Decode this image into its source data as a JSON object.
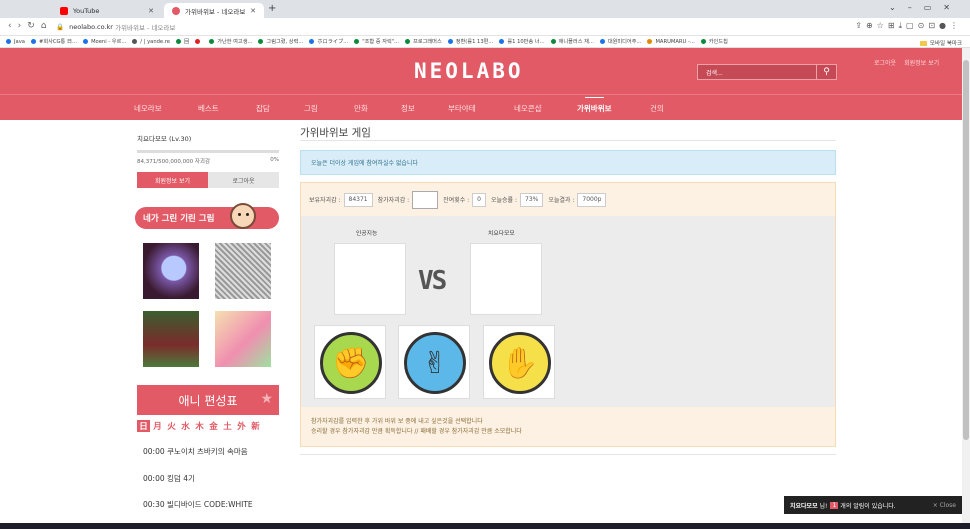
{
  "browser": {
    "tabs": [
      {
        "title": "YouTube",
        "color": "#ff0000",
        "active": false
      },
      {
        "title": "가위바위보 - 네오라보",
        "color": "#e15a65",
        "active": true
      }
    ],
    "new_tab": "+",
    "url_host": "neolabo.co.kr",
    "url_path": "가위바위보 - 네오라보",
    "bookmarks": [
      {
        "label": "Java",
        "color": "#1a73e8"
      },
      {
        "label": "#회사CG통 日...",
        "color": "#1a73e8"
      },
      {
        "label": "Moeni - 우르...",
        "color": "#1a73e8"
      },
      {
        "label": "/ | yande.re",
        "color": "#555555"
      },
      {
        "label": "回",
        "color": "#0a8a3a"
      },
      {
        "label": "",
        "color": "#e02020"
      },
      {
        "label": "가난한 여고생...",
        "color": "#0a8a3a"
      },
      {
        "label": "그림그렸, 상력...",
        "color": "#0a8a3a"
      },
      {
        "label": "ホロライブ...",
        "color": "#1a73e8"
      },
      {
        "label": "\"조합 중 자릭\"...",
        "color": "#0a8a3a"
      },
      {
        "label": "프로그래머스",
        "color": "#0a8a3a"
      },
      {
        "label": "정환(률1 13편...",
        "color": "#1a73e8"
      },
      {
        "label": "률1 10만송 너...",
        "color": "#1a73e8"
      },
      {
        "label": "애니플러스 재...",
        "color": "#0a8a3a"
      },
      {
        "label": "대원미디어주...",
        "color": "#1a73e8"
      },
      {
        "label": "MARUMARU -...",
        "color": "#e08a00"
      },
      {
        "label": "카인드칩",
        "color": "#0a8a3a"
      }
    ],
    "mobile_bookmarks": "모바일 북마크"
  },
  "site": {
    "logo": "NEOLABO",
    "search_placeholder": "검색...",
    "top_links": [
      "로그아웃",
      "회원정보 보기"
    ],
    "menu": [
      {
        "label": "네오라보",
        "active": false
      },
      {
        "label": "베스트",
        "active": false
      },
      {
        "label": "잡담",
        "active": false
      },
      {
        "label": "그림",
        "active": false
      },
      {
        "label": "만화",
        "active": false
      },
      {
        "label": "정보",
        "active": false
      },
      {
        "label": "부타야테",
        "active": false
      },
      {
        "label": "네오콘샵",
        "active": false
      },
      {
        "label": "가위바위보",
        "active": true
      },
      {
        "label": "건의",
        "active": false
      }
    ]
  },
  "sidebar": {
    "user_name": "치요다모모 (Lv.30)",
    "exp": "84,371/500,000,000 자괴감",
    "exp_percent": "0%",
    "btn_info": "회원정보 보기",
    "btn_logout": "로그아웃",
    "banner": "네가 그린 기린 그림",
    "anime_title": "애니 편성표",
    "days": [
      "日",
      "月",
      "火",
      "水",
      "木",
      "金",
      "土",
      "外",
      "新"
    ],
    "selected_day": 0,
    "schedule": [
      {
        "time": "00:00",
        "title": "쿠노이치 츠바키의 속마음"
      },
      {
        "time": "00:00",
        "title": "킹덤 4기"
      },
      {
        "time": "00:30",
        "title": "빌디바이드 CODE:WHITE"
      }
    ]
  },
  "main": {
    "title": "가위바위보 게임",
    "notice": "오늘은 더이상 게임에 참여하실수 없습니다",
    "stats": {
      "owned_label": "보유자괴감 :",
      "owned_value": "84371",
      "bet_label": "참가자괴감 :",
      "remaining_label": "잔여횟수 :",
      "remaining_value": "0",
      "win_rate_label": "오늘승률 :",
      "win_rate_value": "73%",
      "result_label": "오늘결과 :",
      "result_value": "7000p"
    },
    "player_left": "인공지능",
    "player_right": "치요다모모",
    "vs": "VS",
    "choices": [
      {
        "name": "rock",
        "icon": "✊",
        "color": "#a8d84e"
      },
      {
        "name": "scissors",
        "icon": "✌",
        "color": "#5bb8e8"
      },
      {
        "name": "paper",
        "icon": "✋",
        "color": "#f5e04a"
      }
    ],
    "desc_line1": "참가자괴감를 입력한 후 가위 바위 보 중에 내고 싶은것을 선택합니다",
    "desc_line2": "승리할 경우 참가자괴감 만큼 획득합니다 // 패배할 경우 참가자괴감 만큼 소모합니다"
  },
  "notification": {
    "user": "치요다모모",
    "suffix": "님!",
    "count": "1",
    "message": "개의 알림이 있습니다.",
    "close": "× Close"
  }
}
